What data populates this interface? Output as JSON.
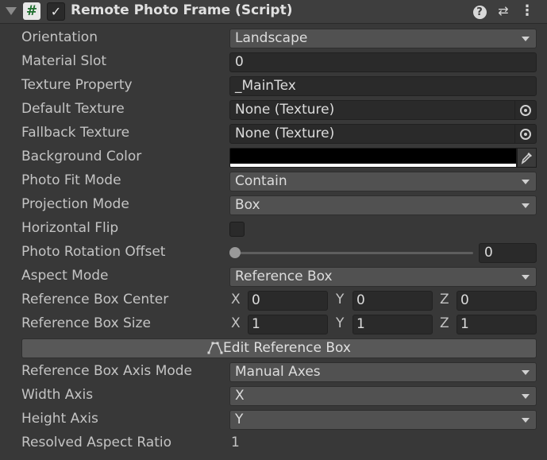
{
  "header": {
    "title": "Remote Photo Frame (Script)",
    "script_glyph": "#",
    "enabled_glyph": "✓",
    "help_glyph": "?",
    "presets_glyph": "⇄",
    "menu_glyph": "⋮"
  },
  "fields": {
    "orientation": {
      "label": "Orientation",
      "value": "Landscape"
    },
    "material_slot": {
      "label": "Material Slot",
      "value": "0"
    },
    "texture_property": {
      "label": "Texture Property",
      "value": "_MainTex"
    },
    "default_texture": {
      "label": "Default Texture",
      "value": "None (Texture)"
    },
    "fallback_texture": {
      "label": "Fallback Texture",
      "value": "None (Texture)"
    },
    "background_color": {
      "label": "Background Color",
      "color": "#000000"
    },
    "photo_fit_mode": {
      "label": "Photo Fit Mode",
      "value": "Contain"
    },
    "projection_mode": {
      "label": "Projection Mode",
      "value": "Box"
    },
    "horizontal_flip": {
      "label": "Horizontal Flip",
      "checked": false
    },
    "photo_rotation_offset": {
      "label": "Photo Rotation Offset",
      "value": "0",
      "fraction": 0
    },
    "aspect_mode": {
      "label": "Aspect Mode",
      "value": "Reference Box"
    },
    "reference_box_center": {
      "label": "Reference Box Center",
      "x_label": "X",
      "y_label": "Y",
      "z_label": "Z",
      "x": "0",
      "y": "0",
      "z": "0"
    },
    "reference_box_size": {
      "label": "Reference Box Size",
      "x_label": "X",
      "y_label": "Y",
      "z_label": "Z",
      "x": "1",
      "y": "1",
      "z": "1"
    },
    "edit_reference_box": {
      "label": "Edit Reference Box"
    },
    "reference_box_axis_mode": {
      "label": "Reference Box Axis Mode",
      "value": "Manual Axes"
    },
    "width_axis": {
      "label": "Width Axis",
      "value": "X"
    },
    "height_axis": {
      "label": "Height Axis",
      "value": "Y"
    },
    "resolved_aspect_ratio": {
      "label": "Resolved Aspect Ratio",
      "value": "1"
    }
  }
}
